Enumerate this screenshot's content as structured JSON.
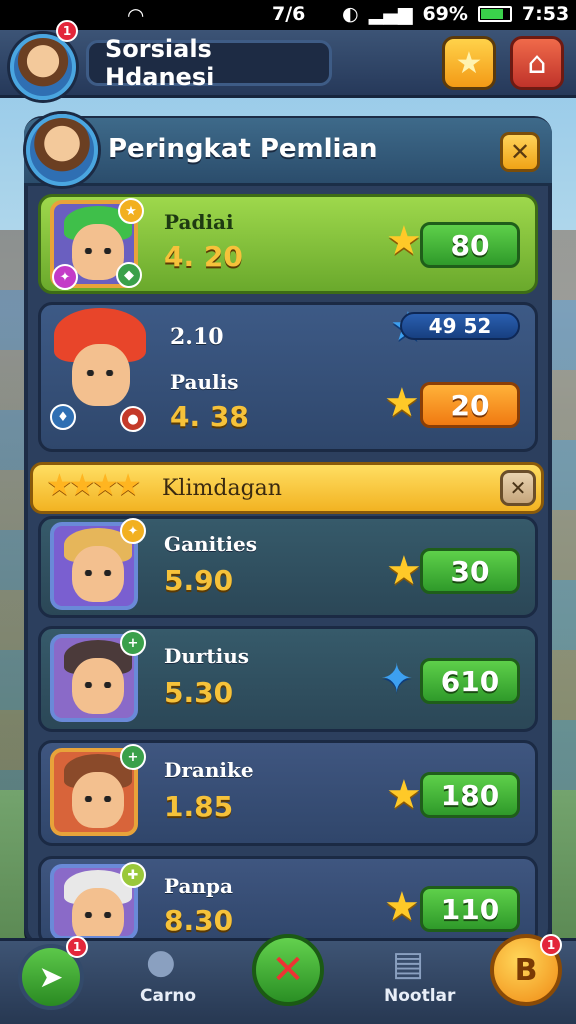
{
  "status_bar": {
    "wifi_icon": "wifi-icon",
    "left_time": "7/6",
    "battery_percent": "69%",
    "time": "7:53"
  },
  "header": {
    "title": "Sorsials Hdanesi",
    "avatar_badge": "1"
  },
  "panel": {
    "title": "Peringkat Pemlian",
    "close_label": "✕"
  },
  "players_top": [
    {
      "name": "Padiai",
      "value": "4. 20",
      "score": "80",
      "hair": "#3fbf4a",
      "portrait_border": "#e8a33a"
    },
    {
      "name": "Paulis",
      "value": "4. 38",
      "extra_value": "2.10",
      "rank_pill": "49 52",
      "score": "20",
      "hair": "#e8452a",
      "portrait_border": "#c9452a"
    }
  ],
  "section": {
    "title": "Klimdagan",
    "close_label": "✕"
  },
  "players": [
    {
      "name": "Ganities",
      "value": "5.90",
      "score": "30",
      "hair": "#e6b65a"
    },
    {
      "name": "Durtius",
      "value": "5.30",
      "score": "610",
      "hair": "#4b3a3a"
    },
    {
      "name": "Dranike",
      "value": "1.85",
      "score": "180",
      "hair": "#8a4a2a"
    },
    {
      "name": "Panpa",
      "value": "8.30",
      "score": "110",
      "hair": "#e8e8e8"
    }
  ],
  "bottom_nav": {
    "left_badge": "1",
    "item_2_label": "Carno",
    "item_4_label": "Nootlar",
    "coin_label": "B",
    "coin_badge": "1"
  }
}
